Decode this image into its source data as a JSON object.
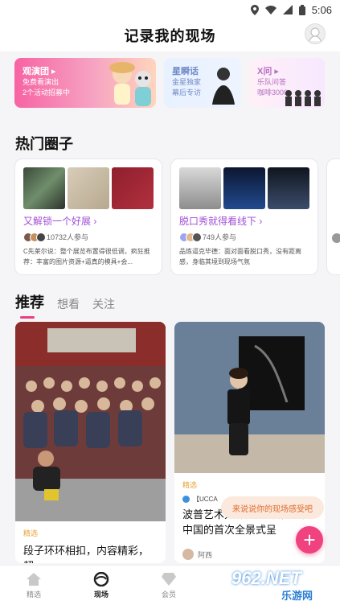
{
  "status_bar": {
    "time": "5:06"
  },
  "header": {
    "title": "记录我的现场"
  },
  "banners": [
    {
      "title": "观演团 ▸",
      "subtitle": "免费看演出\n2个活动招募中"
    },
    {
      "title": "星瞬话",
      "subtitle": "金星独家\n幕后专访"
    },
    {
      "title": "X问 ▸",
      "subtitle": "乐队问答\n咖啡3000"
    }
  ],
  "hot_circles": {
    "title": "热门圈子",
    "items": [
      {
        "title": "又解锁一个好展 ›",
        "members": "10732人参与",
        "desc": "C先莱尔说：整个展览布置得很低调，疯狂推荐：丰富的图片资源+逼真的模具+会..."
      },
      {
        "title": "脱口秀就得看线下 ›",
        "members": "749人参与",
        "desc": "品炼逼克毕德：面对面看脱口秀，没有距离感，身临其境到现场气氛"
      }
    ]
  },
  "feed_tabs": [
    "推荐",
    "想看",
    "关注"
  ],
  "feed": [
    {
      "tag": "精选",
      "title": "段子环环相扣，内容精彩，超"
    },
    {
      "tag": "精选",
      "source": "【UCCA",
      "title": "波普艺术大师安迪·沃霍尔在中国的首次全景式呈",
      "author": "阿西"
    }
  ],
  "toast": "来说说你的现场感受吧",
  "fab_label": "+",
  "bottom_nav": [
    {
      "label": "精选",
      "active": false
    },
    {
      "label": "现场",
      "active": true
    },
    {
      "label": "会员",
      "active": false
    }
  ],
  "watermark": {
    "text": "962.NET",
    "subtext": "乐游网"
  }
}
